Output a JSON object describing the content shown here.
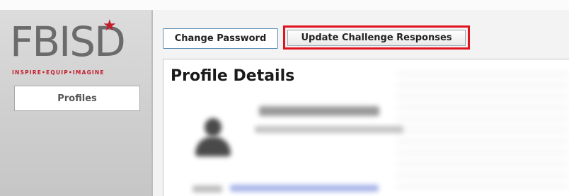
{
  "brand": {
    "logo_text": "FBISD",
    "tagline": "INSPIRE•EQUIP•IMAGINE",
    "colors": {
      "logo_gray": "#6b6b6b",
      "accent_red": "#c31d2c"
    }
  },
  "sidebar": {
    "items": [
      {
        "label": "Profiles"
      }
    ]
  },
  "tabs": [
    {
      "label": "Change Password"
    },
    {
      "label": "Update Challenge Responses",
      "highlighted": true,
      "highlight_color": "#e0141e"
    }
  ],
  "main": {
    "title": "Profile Details"
  },
  "icons": {
    "avatar": "user-silhouette-icon",
    "logo_star": "star-icon"
  }
}
